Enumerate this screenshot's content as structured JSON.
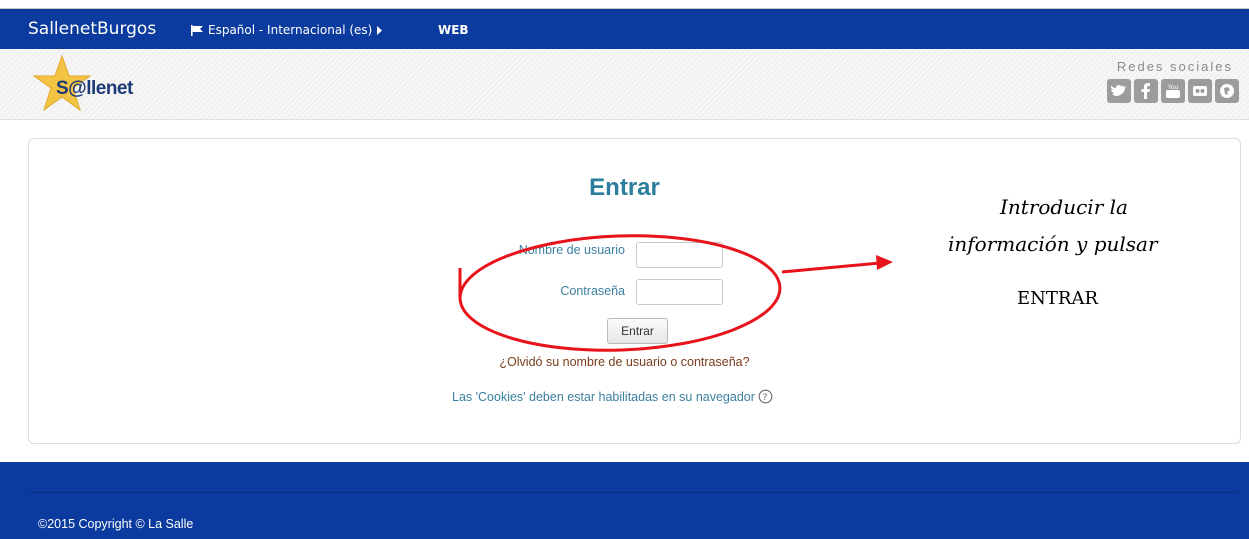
{
  "topbar": {
    "brand": "SallenetBurgos",
    "language": "Español - Internacional (es)",
    "web_link": "WEB"
  },
  "header": {
    "logo_text": "S@llenet",
    "social_title": "Redes sociales",
    "social_icons": [
      "twitter-icon",
      "facebook-icon",
      "youtube-icon",
      "flickr-icon",
      "web-icon"
    ]
  },
  "login": {
    "title": "Entrar",
    "username_label": "Nombre de usuario",
    "username_value": "",
    "password_label": "Contraseña",
    "password_value": "",
    "submit_label": "Entrar",
    "forgot_link": "¿Olvidó su nombre de usuario o contraseña?",
    "cookies_notice": "Las 'Cookies' deben estar habilitadas en su navegador"
  },
  "annotation": {
    "line1": "Introducir la",
    "line2": "información y pulsar",
    "line3": "ENTRAR",
    "color": "#e8141b"
  },
  "footer": {
    "copyright": "©2015 Copyright © La Salle"
  },
  "colors": {
    "navbar": "#0b3b9e",
    "title": "#2a7d9c"
  }
}
